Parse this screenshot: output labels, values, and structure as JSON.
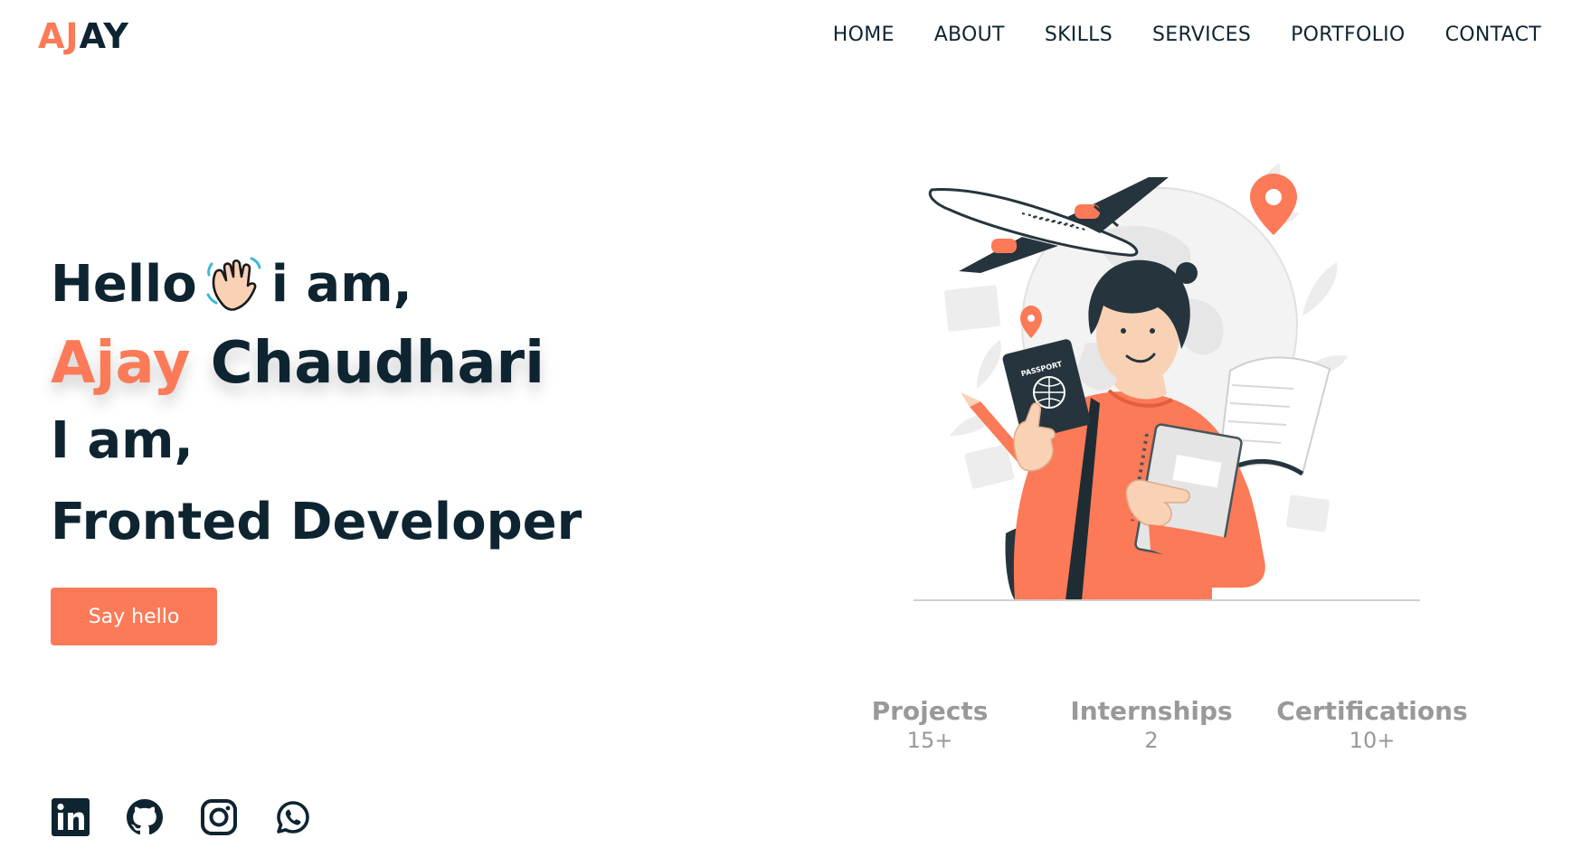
{
  "header": {
    "logo_a": "AJ",
    "logo_b": "AY",
    "nav": [
      "HOME",
      "ABOUT",
      "SKILLS",
      "SERVICES",
      "PORTFOLIO",
      "CONTACT"
    ]
  },
  "hero": {
    "hello": "Hello",
    "iam": "i am,",
    "first_name": "Ajay",
    "last_name": "Chaudhari",
    "iam2": "I am,",
    "role": "Fronted Developer",
    "cta_label": "Say hello"
  },
  "illustration": {
    "passport_text": "PASSPORT"
  },
  "stats": [
    {
      "label": "Projects",
      "value": "15+"
    },
    {
      "label": "Internships",
      "value": "2"
    },
    {
      "label": "Certifications",
      "value": "10+"
    }
  ],
  "social": [
    "linkedin-icon",
    "github-icon",
    "instagram-icon",
    "whatsapp-icon"
  ],
  "colors": {
    "accent": "#fc7a57",
    "dark": "#0e2431",
    "muted": "#999999"
  }
}
